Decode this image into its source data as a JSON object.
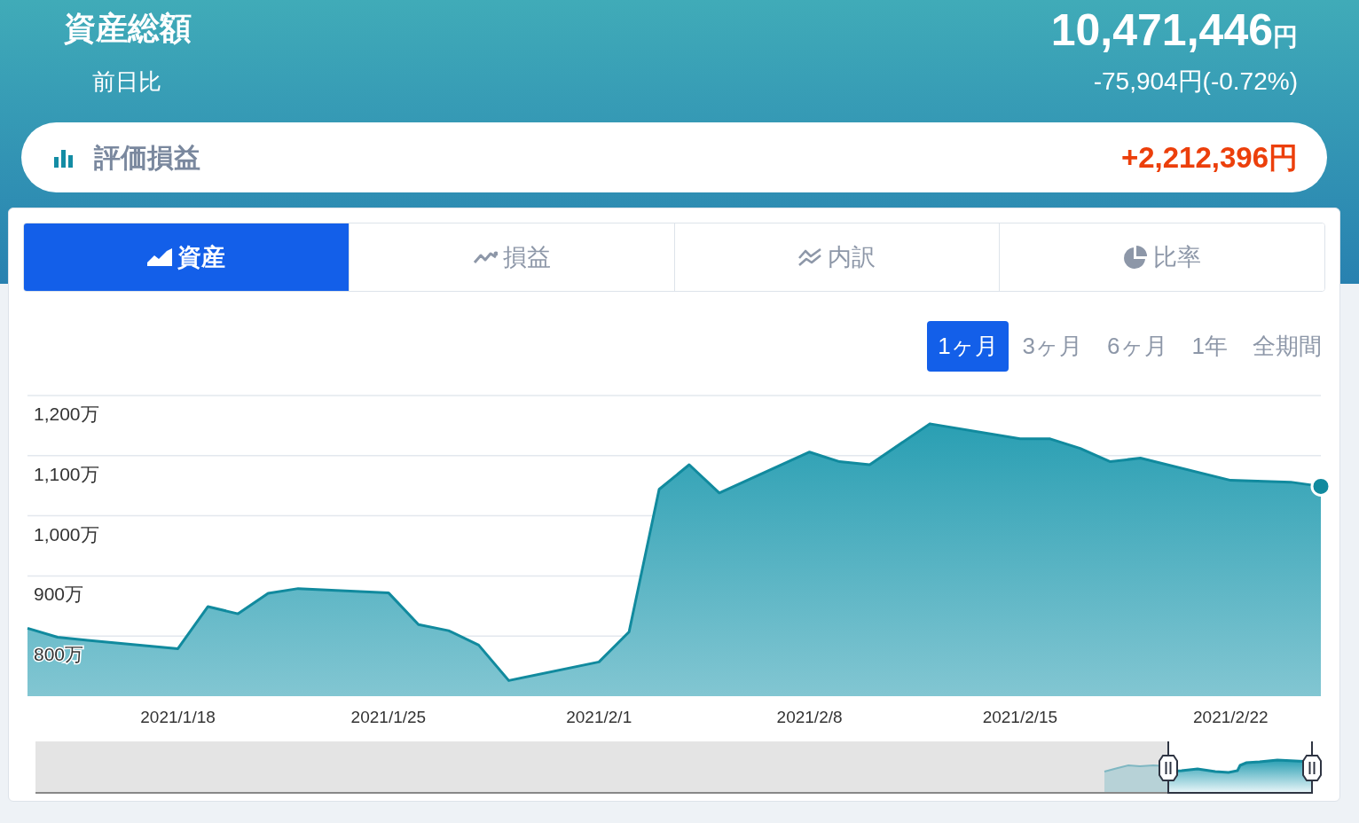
{
  "summary": {
    "title": "資産総額",
    "total": "10,471,446",
    "total_unit": "円",
    "change_label": "前日比",
    "change": "-75,904円(-0.72%)"
  },
  "profit_bar": {
    "label": "評価損益",
    "value": "+2,212,396円"
  },
  "tabs": [
    {
      "label": "資産",
      "selected": true
    },
    {
      "label": "損益",
      "selected": false
    },
    {
      "label": "内訳",
      "selected": false
    },
    {
      "label": "比率",
      "selected": false
    }
  ],
  "periods": [
    {
      "label": "1ヶ月",
      "selected": true
    },
    {
      "label": "3ヶ月",
      "selected": false
    },
    {
      "label": "6ヶ月",
      "selected": false
    },
    {
      "label": "1年",
      "selected": false
    },
    {
      "label": "全期間",
      "selected": false
    }
  ],
  "chart": {
    "chart_data": {
      "type": "area",
      "categories": [
        null,
        null,
        null,
        null,
        null,
        "2021/1/18",
        null,
        null,
        null,
        null,
        null,
        null,
        "2021/1/25",
        null,
        null,
        null,
        null,
        null,
        null,
        "2021/2/1",
        null,
        null,
        null,
        null,
        null,
        null,
        "2021/2/8",
        null,
        null,
        null,
        null,
        null,
        null,
        "2021/2/15",
        null,
        null,
        null,
        null,
        null,
        null,
        "2021/2/22",
        null,
        null,
        null
      ],
      "series": [
        {
          "color": "#118a9e",
          "values": [
            813,
            798,
            793,
            null,
            null,
            779,
            849,
            837,
            871,
            879,
            null,
            null,
            872,
            819,
            809,
            785,
            726,
            null,
            null,
            757,
            807,
            1044,
            1085,
            1038,
            null,
            null,
            1106,
            1090,
            1085,
            null,
            1153,
            null,
            null,
            1128,
            1128,
            1112,
            1090,
            1096,
            null,
            null,
            1059,
            null,
            1056,
            1049
          ]
        }
      ],
      "ylim": [
        700,
        1200
      ],
      "grid": true,
      "yticks": [
        {
          "value": 800,
          "label": "800万"
        },
        {
          "value": 900,
          "label": "900万"
        },
        {
          "value": 1000,
          "label": "1,000万"
        },
        {
          "value": 1100,
          "label": "1,100万"
        },
        {
          "value": 1200,
          "label": "1,200万"
        }
      ]
    }
  }
}
